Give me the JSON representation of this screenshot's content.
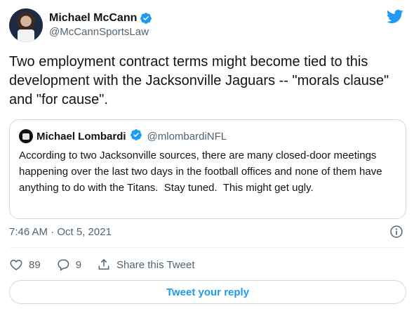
{
  "author": {
    "display_name": "Michael McCann",
    "handle": "@McCannSportsLaw",
    "avatar_icon": "profile-photo",
    "verified_icon": "verified-badge-icon"
  },
  "brand": {
    "logo_icon": "twitter-bird-icon",
    "accent": "#1d9bf0"
  },
  "tweet": {
    "text": "Two employment contract terms might become tied to this development with the Jacksonville Jaguars -- \"morals clause\" and \"for cause\".",
    "timestamp": "7:46 AM · Oct 5, 2021"
  },
  "quoted_tweet": {
    "display_name": "Michael Lombardi",
    "handle": "@mlombardiNFL",
    "text": "According to two Jacksonville sources, there are many closed-door meetings happening over the last two days in the football offices and none of them have anything to do with the Titans.  Stay tuned.  This might get ugly."
  },
  "actions": {
    "like_count": "89",
    "reply_count": "9",
    "share_label": "Share this Tweet"
  },
  "reply_button_label": "Tweet your reply"
}
